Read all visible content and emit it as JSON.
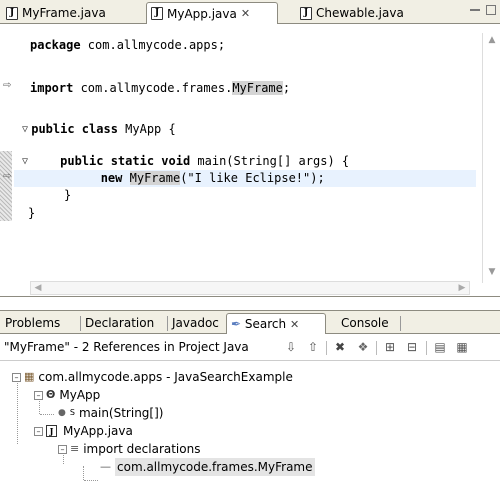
{
  "editor": {
    "tabs": [
      {
        "label": "MyFrame.java",
        "active": false
      },
      {
        "label": "MyApp.java",
        "active": true,
        "close": "✕"
      },
      {
        "label": "Chewable.java",
        "active": false
      }
    ],
    "code": {
      "line1": {
        "kw": "package",
        "rest": " com.allmycode.apps;"
      },
      "line2": {
        "kw": "import",
        "mid": " com.allmycode.frames.",
        "occ": "MyFrame",
        "end": ";"
      },
      "line3": {
        "kw": "public class",
        "rest": " MyApp {"
      },
      "line4": {
        "kw": "public static void",
        "rest": " main(String[] args) {"
      },
      "line5": {
        "kw": "new",
        "occ": "MyFrame",
        "rest": "(\"I like Eclipse!\");"
      },
      "line6": "}",
      "line7": "}"
    }
  },
  "panel": {
    "tabs": [
      "Problems",
      "Declaration",
      "Javadoc",
      "Search",
      "Console"
    ],
    "search_close": "✕",
    "summary": "\"MyFrame\" - 2 References in Project Java",
    "tree": {
      "package": "com.allmycode.apps - JavaSearchExample",
      "class": "MyApp",
      "method": "main(String[])",
      "method_mod": "S",
      "file": "MyApp.java",
      "imports": "import declarations",
      "import_item": "com.allmycode.frames.MyFrame"
    }
  },
  "colors": {
    "chrome": "#f1efe4",
    "highlight_line": "#e8f2fe",
    "occurrence": "#d4d4d4"
  }
}
